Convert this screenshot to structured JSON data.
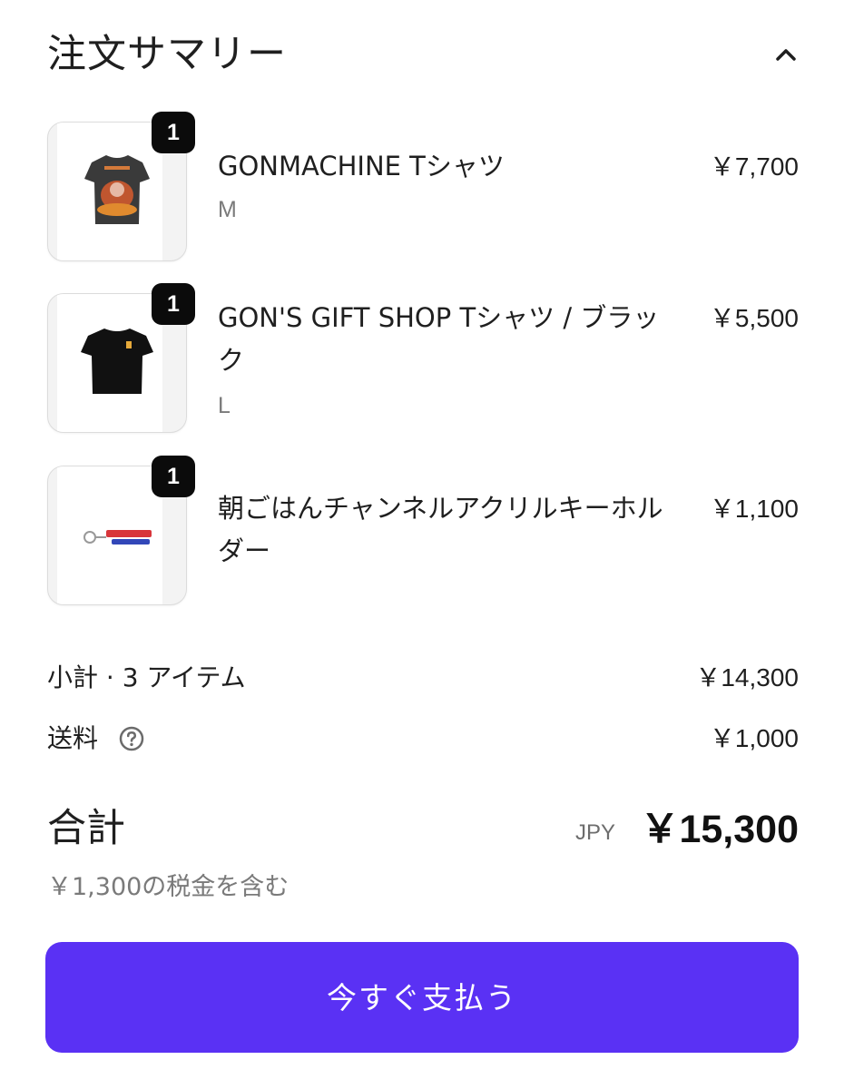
{
  "summary": {
    "title": "注文サマリー",
    "collapse_icon": "chevron-up-icon"
  },
  "items": [
    {
      "quantity": "1",
      "name": "GONMACHINE Tシャツ",
      "variant": "M",
      "price": "￥7,700"
    },
    {
      "quantity": "1",
      "name": "GON'S GIFT SHOP Tシャツ / ブラック",
      "variant": "L",
      "price": "￥5,500"
    },
    {
      "quantity": "1",
      "name": "朝ごはんチャンネルアクリルキーホルダー",
      "variant": "",
      "price": "￥1,100"
    }
  ],
  "subtotal": {
    "label": "小計 · 3 アイテム",
    "value": "￥14,300"
  },
  "shipping": {
    "label": "送料",
    "help_icon": "question-circle-icon",
    "value": "￥1,000"
  },
  "total": {
    "label": "合計",
    "currency": "JPY",
    "value": "￥15,300",
    "tax_note": "￥1,300の税金を含む"
  },
  "pay_button": {
    "label": "今すぐ支払う",
    "color": "#5a31f4"
  }
}
